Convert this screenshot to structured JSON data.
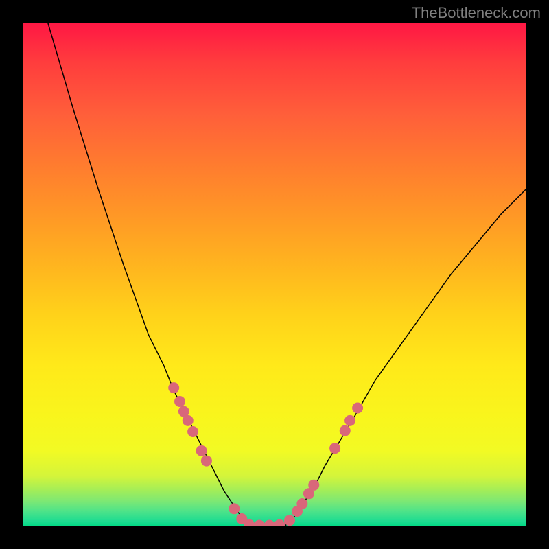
{
  "watermark": "TheBottleneck.com",
  "chart_data": {
    "type": "line",
    "title": "",
    "xlabel": "",
    "ylabel": "",
    "xlim": [
      0,
      100
    ],
    "ylim": [
      0,
      100
    ],
    "grid": false,
    "legend": false,
    "curve_left": {
      "x": [
        5,
        10,
        15,
        20,
        25,
        28,
        30,
        32,
        34,
        36,
        38,
        40,
        42,
        44,
        45
      ],
      "y": [
        100,
        83,
        67,
        52,
        38,
        32,
        27,
        23,
        19,
        15,
        11,
        7,
        4,
        1,
        0
      ]
    },
    "curve_flat": {
      "x": [
        45,
        46,
        47,
        48,
        49,
        50,
        51,
        52
      ],
      "y": [
        0,
        0,
        0,
        0,
        0,
        0,
        0,
        0
      ]
    },
    "curve_right": {
      "x": [
        52,
        54,
        56,
        58,
        60,
        63,
        66,
        70,
        75,
        80,
        85,
        90,
        95,
        100
      ],
      "y": [
        0,
        2,
        5,
        8,
        12,
        17,
        22,
        29,
        36,
        43,
        50,
        56,
        62,
        67
      ]
    },
    "markers": [
      {
        "x": 30.0,
        "y": 27.5
      },
      {
        "x": 31.2,
        "y": 24.8
      },
      {
        "x": 32.0,
        "y": 22.8
      },
      {
        "x": 32.8,
        "y": 21.0
      },
      {
        "x": 33.8,
        "y": 18.8
      },
      {
        "x": 35.5,
        "y": 15.0
      },
      {
        "x": 36.5,
        "y": 13.0
      },
      {
        "x": 42.0,
        "y": 3.5
      },
      {
        "x": 43.5,
        "y": 1.5
      },
      {
        "x": 45.0,
        "y": 0.3
      },
      {
        "x": 47.0,
        "y": 0.2
      },
      {
        "x": 49.0,
        "y": 0.2
      },
      {
        "x": 51.0,
        "y": 0.3
      },
      {
        "x": 53.0,
        "y": 1.2
      },
      {
        "x": 54.5,
        "y": 3.0
      },
      {
        "x": 55.5,
        "y": 4.5
      },
      {
        "x": 56.8,
        "y": 6.5
      },
      {
        "x": 57.8,
        "y": 8.2
      },
      {
        "x": 62.0,
        "y": 15.5
      },
      {
        "x": 64.0,
        "y": 19.0
      },
      {
        "x": 65.0,
        "y": 21.0
      },
      {
        "x": 66.5,
        "y": 23.5
      }
    ],
    "marker_color": "#d9677a",
    "marker_radius_px": 8
  }
}
